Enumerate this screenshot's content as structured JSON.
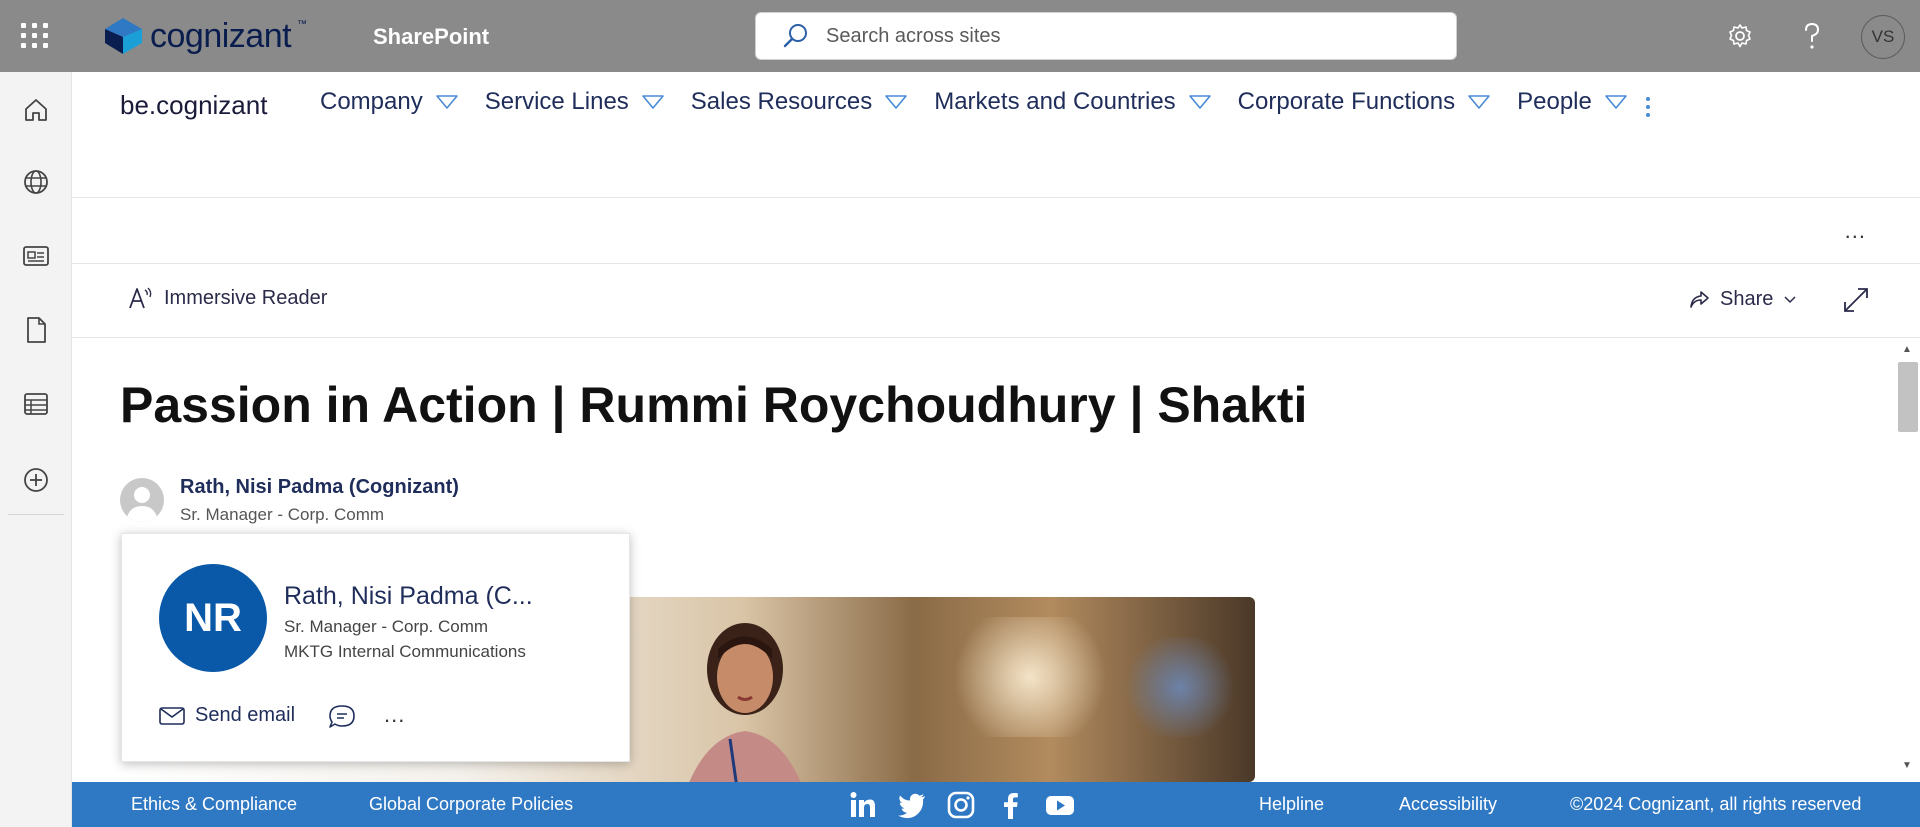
{
  "suitebar": {
    "logo_text": "cognizant",
    "logo_tm": "™",
    "app_name": "SharePoint",
    "search_placeholder": "Search across sites",
    "user_initials": "VS"
  },
  "site": {
    "title": "be.cognizant",
    "nav": [
      {
        "label": "Company"
      },
      {
        "label": "Service Lines"
      },
      {
        "label": "Sales Resources"
      },
      {
        "label": "Markets and Countries"
      },
      {
        "label": "Corporate Functions"
      },
      {
        "label": "People"
      }
    ]
  },
  "cmdbar": {
    "more": "..."
  },
  "toolbar": {
    "immersive_reader": "Immersive Reader",
    "share": "Share"
  },
  "article": {
    "title": "Passion in Action | Rummi Roychoudhury | Shakti",
    "author_name": "Rath, Nisi Padma (Cognizant)",
    "author_role": "Sr. Manager - Corp. Comm"
  },
  "profile_card": {
    "initials": "NR",
    "name": "Rath, Nisi Padma (C...",
    "role": "Sr. Manager - Corp. Comm",
    "department": "MKTG Internal Communications",
    "send_email": "Send email",
    "more": "..."
  },
  "footer": {
    "ethics": "Ethics & Compliance",
    "policies": "Global Corporate Policies",
    "helpline": "Helpline",
    "accessibility": "Accessibility",
    "copyright": "©2024 Cognizant, all rights reserved",
    "social_icons": [
      "linkedin-icon",
      "twitter-icon",
      "instagram-icon",
      "facebook-icon",
      "youtube-icon"
    ]
  },
  "colors": {
    "suitebar": "#8a8a8a",
    "footer": "#2f78c4",
    "profile_avatar": "#0a59a8",
    "nav_text": "#1f2d5a"
  }
}
